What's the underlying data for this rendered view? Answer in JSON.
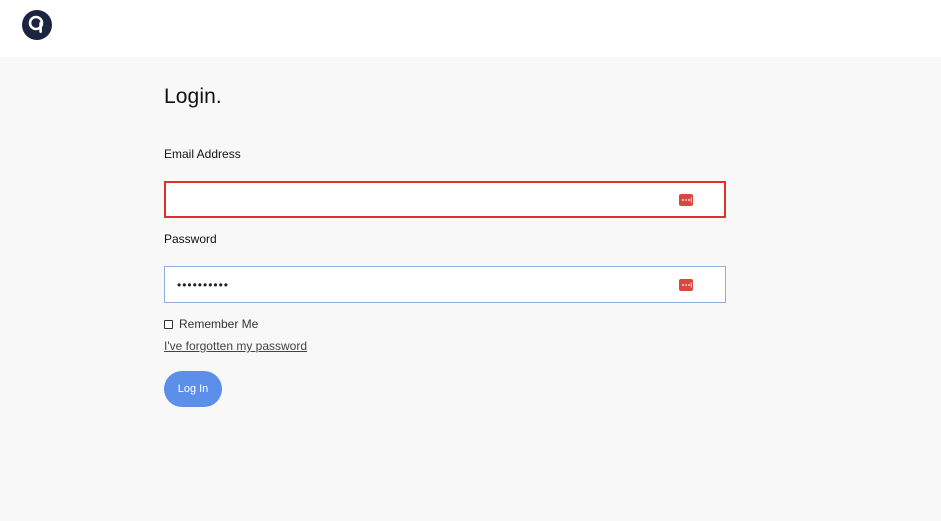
{
  "header": {
    "logo_icon": "q-logo-icon"
  },
  "form": {
    "title": "Login.",
    "email": {
      "label": "Email Address",
      "value": "",
      "state": "error",
      "icon": "password-manager-icon"
    },
    "password": {
      "label": "Password",
      "value": "••••••••••",
      "icon": "password-manager-icon"
    },
    "remember_label": "Remember Me",
    "remember_checked": false,
    "forgot_link": "I've forgotten my password",
    "submit_label": "Log In"
  },
  "colors": {
    "accent": "#5b8fea",
    "error": "#e0302a",
    "icon_red": "#d9473f",
    "logo_bg": "#1b2440"
  }
}
